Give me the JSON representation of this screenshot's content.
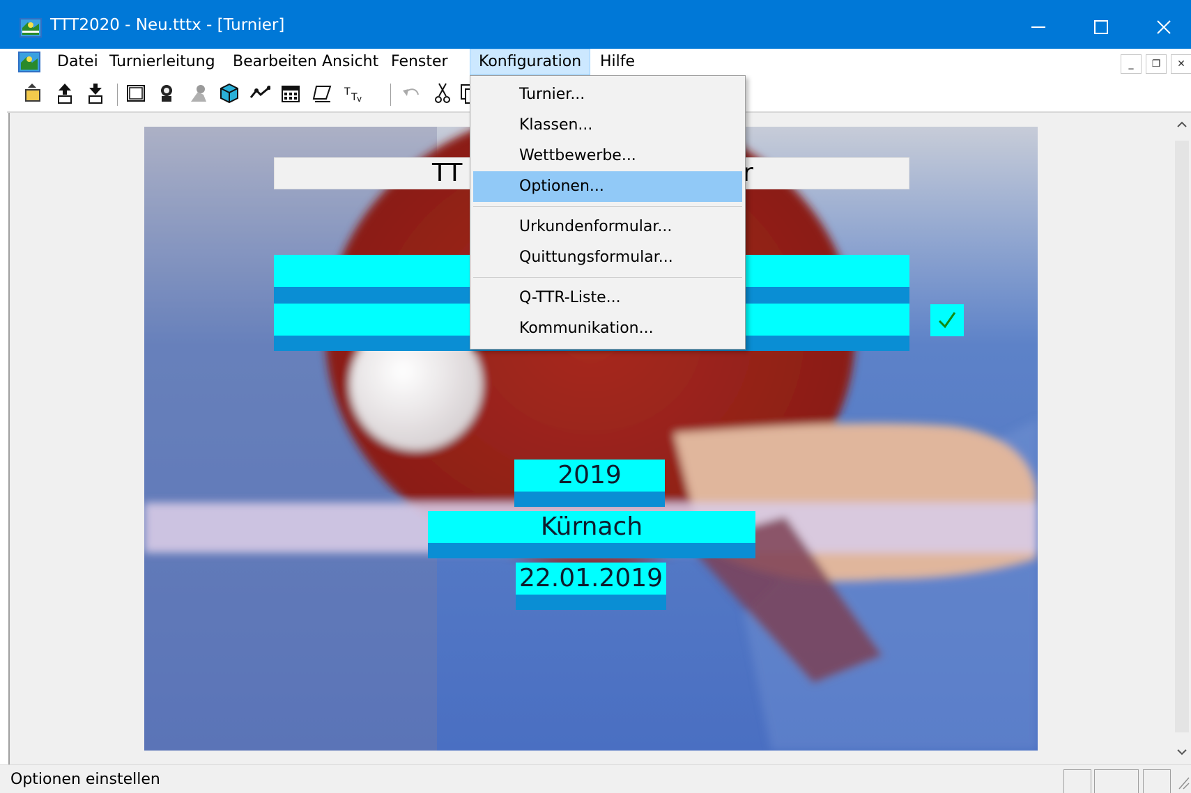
{
  "window": {
    "title": "TTT2020 - Neu.tttx - [Turnier]",
    "minimize_glyph": "—",
    "maximize_glyph": "☐",
    "close_glyph": "✕"
  },
  "menu": {
    "items": [
      "Datei",
      "Turnierleitung",
      "Bearbeiten",
      "Ansicht",
      "Fenster",
      "Konfiguration",
      "Hilfe"
    ],
    "active": "Konfiguration"
  },
  "mdi": {
    "minimize": "_",
    "restore": "❐",
    "close": "✕"
  },
  "dropdown": {
    "items": [
      "Turnier...",
      "Klassen...",
      "Wettbewerbe...",
      "Optionen...",
      "Urkundenformular...",
      "Quittungsformular...",
      "Q-TTR-Liste...",
      "Kommunikation..."
    ],
    "highlighted": "Optionen..."
  },
  "content": {
    "title_partial_left": "TT",
    "title_partial_right": "r",
    "year": "2019",
    "location": "Kürnach",
    "date": "22.01.2019",
    "check_mark": "✓"
  },
  "toolbar": {
    "icons": [
      "open-icon",
      "import-icon",
      "export-icon",
      "window-icon",
      "player-icon",
      "referee-icon",
      "cube-icon",
      "tree-icon",
      "calendar-icon",
      "erase-icon",
      "text-icon",
      "undo-icon",
      "cut-icon",
      "copy-icon"
    ]
  },
  "statusbar": {
    "text": "Optionen einstellen"
  },
  "colors": {
    "titlebar": "#0078d7",
    "field": "#00ffff",
    "field_shadow": "#0a8ed4",
    "highlight": "#91c9f7"
  }
}
